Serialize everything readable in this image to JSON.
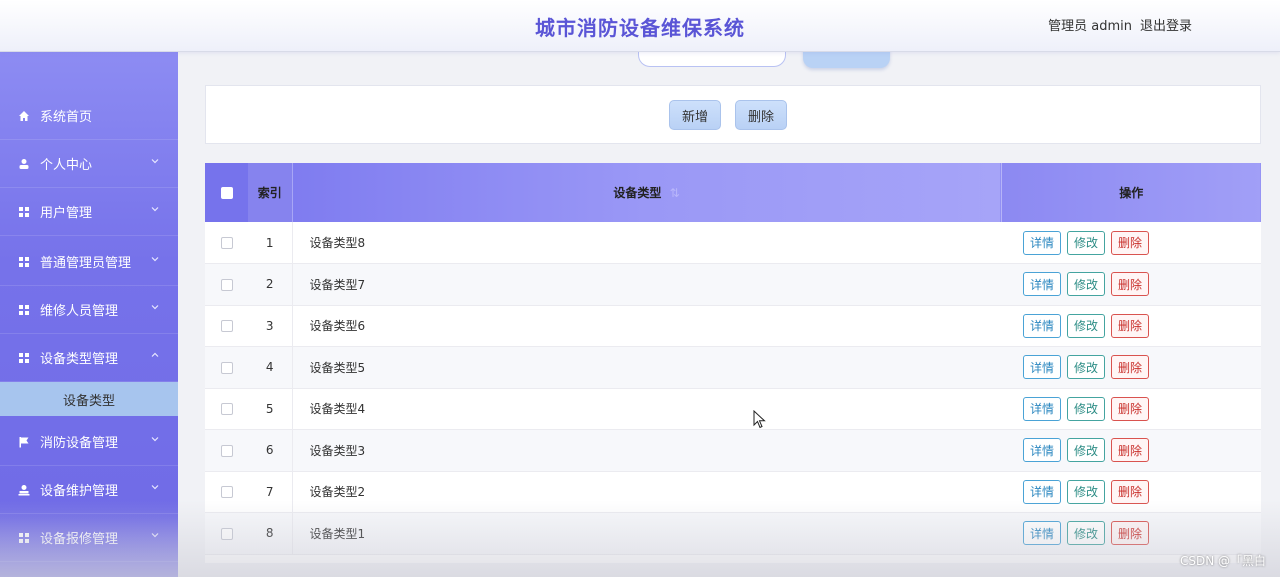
{
  "header": {
    "title": "城市消防设备维保系统",
    "user_label": "管理员 admin",
    "logout_label": "退出登录"
  },
  "sidebar": {
    "items": [
      {
        "label": "系统首页",
        "icon": "home-icon",
        "chevron": null
      },
      {
        "label": "个人中心",
        "icon": "person-icon",
        "chevron": "down"
      },
      {
        "label": "用户管理",
        "icon": "grid-icon",
        "chevron": "down"
      },
      {
        "label": "普通管理员管理",
        "icon": "grid-icon",
        "chevron": "down"
      },
      {
        "label": "维修人员管理",
        "icon": "grid-icon",
        "chevron": "down"
      },
      {
        "label": "设备类型管理",
        "icon": "grid-icon",
        "chevron": "up"
      },
      {
        "label": "消防设备管理",
        "icon": "flag-icon",
        "chevron": "down"
      },
      {
        "label": "设备维护管理",
        "icon": "person-icon",
        "chevron": "down"
      },
      {
        "label": "设备报修管理",
        "icon": "grid-icon",
        "chevron": "down"
      }
    ],
    "active_subitem": "设备类型"
  },
  "actions": {
    "add_label": "新增",
    "delete_label": "删除"
  },
  "table": {
    "headers": {
      "index": "索引",
      "type": "设备类型",
      "sort_indicator": "⇅",
      "ops": "操作"
    },
    "rows": [
      {
        "index": "1",
        "type": "设备类型8"
      },
      {
        "index": "2",
        "type": "设备类型7"
      },
      {
        "index": "3",
        "type": "设备类型6"
      },
      {
        "index": "4",
        "type": "设备类型5"
      },
      {
        "index": "5",
        "type": "设备类型4"
      },
      {
        "index": "6",
        "type": "设备类型3"
      },
      {
        "index": "7",
        "type": "设备类型2"
      },
      {
        "index": "8",
        "type": "设备类型1"
      }
    ],
    "row_actions": {
      "detail": "详情",
      "edit": "修改",
      "delete": "删除"
    }
  },
  "watermark": "CSDN @「黑白",
  "colors": {
    "title": "#5a55d6",
    "sidebar": "#7672ea",
    "header_row": "#8f8cf3",
    "active_subitem": "#a7c5ee",
    "detail": "#2b87c0",
    "edit": "#2d8d86",
    "delete": "#c9302c"
  }
}
